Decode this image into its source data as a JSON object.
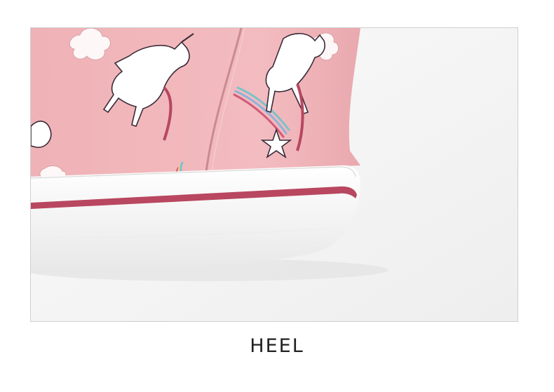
{
  "caption": "HEEL",
  "colors": {
    "canvas_pink": "#f2b8bc",
    "sole_white": "#f9f9f9",
    "foxing_stripe": "#b8475f",
    "background": "#f5f5f5",
    "frame_border": "#cfcfcf",
    "caption_text": "#222222"
  },
  "icons": [
    "unicorn-print",
    "rainbow-tail",
    "star-print",
    "cloud-print"
  ]
}
